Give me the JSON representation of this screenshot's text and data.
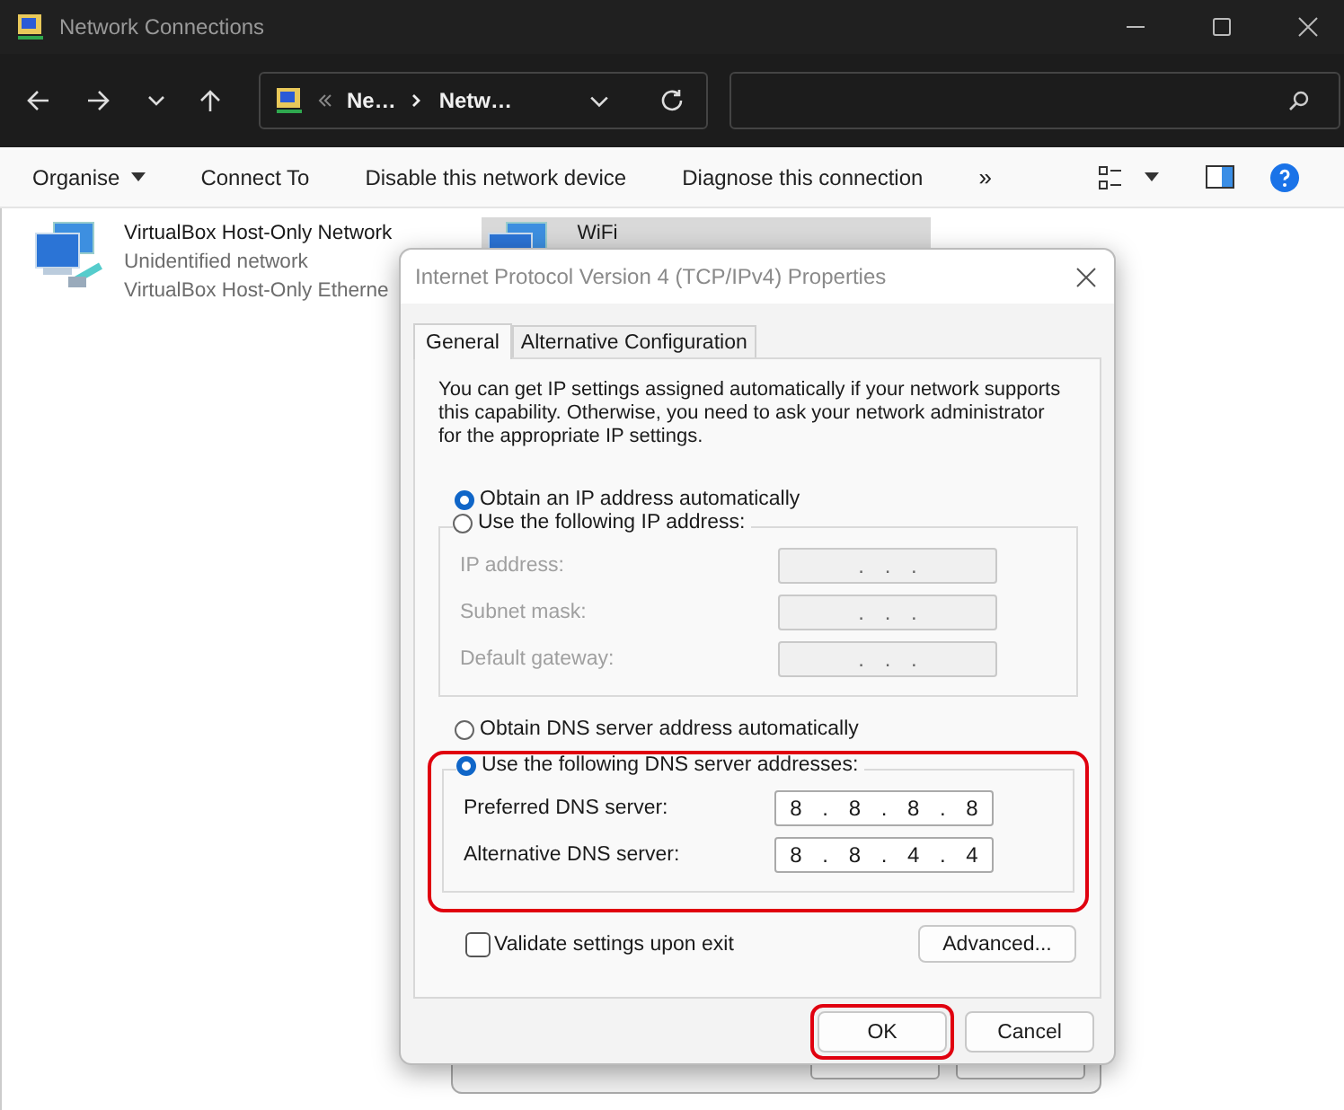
{
  "window": {
    "title": "Network Connections"
  },
  "address_bar": {
    "crumbs": [
      "Ne…",
      "Netw…"
    ]
  },
  "command_bar": {
    "items": [
      {
        "label": "Organise",
        "dropdown": true
      },
      {
        "label": "Connect To",
        "dropdown": false
      },
      {
        "label": "Disable this network device",
        "dropdown": false
      },
      {
        "label": "Diagnose this connection",
        "dropdown": false
      }
    ],
    "overflow": "»"
  },
  "connections": [
    {
      "name": "VirtualBox Host-Only Network",
      "status": "Unidentified network",
      "adapter": "VirtualBox Host-Only Etherne",
      "selected": false
    },
    {
      "name": "WiFi",
      "selected": true
    }
  ],
  "dialog": {
    "title": "Internet Protocol Version 4 (TCP/IPv4) Properties",
    "tabs": [
      {
        "label": "General",
        "selected": true
      },
      {
        "label": "Alternative Configuration",
        "selected": false
      }
    ],
    "description": "You can get IP settings assigned automatically if your network supports this capability. Otherwise, you need to ask your network administrator for the appropriate IP settings.",
    "ip_modes": [
      {
        "label": "Obtain an IP address automatically",
        "selected": true
      },
      {
        "label": "Use the following IP address:",
        "selected": false
      }
    ],
    "ip_fields": [
      {
        "label": "IP address:",
        "value": ". . .",
        "disabled": true
      },
      {
        "label": "Subnet mask:",
        "value": ". . .",
        "disabled": true
      },
      {
        "label": "Default gateway:",
        "value": ". . .",
        "disabled": true
      }
    ],
    "dns_modes": [
      {
        "label": "Obtain DNS server address automatically",
        "selected": false
      },
      {
        "label": "Use the following DNS server addresses:",
        "selected": true
      }
    ],
    "dns_highlighted": true,
    "dns_fields": [
      {
        "label": "Preferred DNS server:",
        "value": "8 . 8 . 8 . 8",
        "disabled": false
      },
      {
        "label": "Alternative DNS server:",
        "value": "8 . 8 . 4 . 4",
        "disabled": false
      }
    ],
    "validate": {
      "label": "Validate settings upon exit",
      "checked": false
    },
    "advanced_button": "Advanced...",
    "buttons": [
      {
        "label": "OK",
        "highlighted": true
      },
      {
        "label": "Cancel",
        "highlighted": false
      }
    ]
  }
}
